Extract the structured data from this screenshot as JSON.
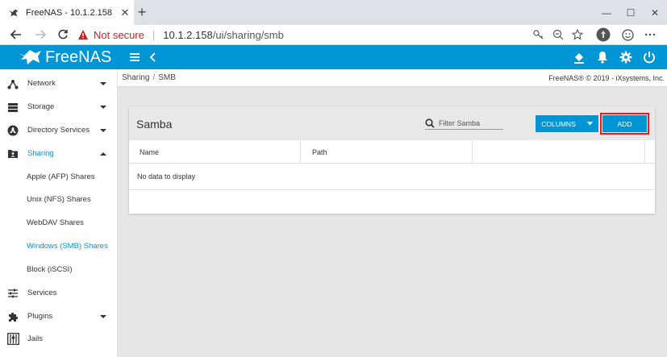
{
  "browser": {
    "tab_title": "FreeNAS - 10.1.2.158",
    "security_label": "Not secure",
    "url_host": "10.1.2.158",
    "url_path": "/ui/sharing/smb"
  },
  "app": {
    "logo_text": "FreeNAS"
  },
  "sidebar": {
    "items": [
      {
        "label": "Network"
      },
      {
        "label": "Storage"
      },
      {
        "label": "Directory Services"
      },
      {
        "label": "Sharing"
      },
      {
        "label": "Apple (AFP) Shares"
      },
      {
        "label": "Unix (NFS) Shares"
      },
      {
        "label": "WebDAV Shares"
      },
      {
        "label": "Windows (SMB) Shares"
      },
      {
        "label": "Block (iSCSI)"
      },
      {
        "label": "Services"
      },
      {
        "label": "Plugins"
      },
      {
        "label": "Jails"
      }
    ]
  },
  "breadcrumb": [
    "Sharing",
    "SMB"
  ],
  "copyright": "FreeNAS® © 2019 - iXsystems, Inc.",
  "card": {
    "title": "Samba",
    "filter_placeholder": "Filter Samba",
    "columns_label": "COLUMNS",
    "add_label": "ADD",
    "headers": [
      "Name",
      "Path"
    ],
    "empty_text": "No data to display"
  },
  "colors": {
    "accent": "#0095d5",
    "highlight": "#e02020",
    "warning": "#c5221f"
  }
}
